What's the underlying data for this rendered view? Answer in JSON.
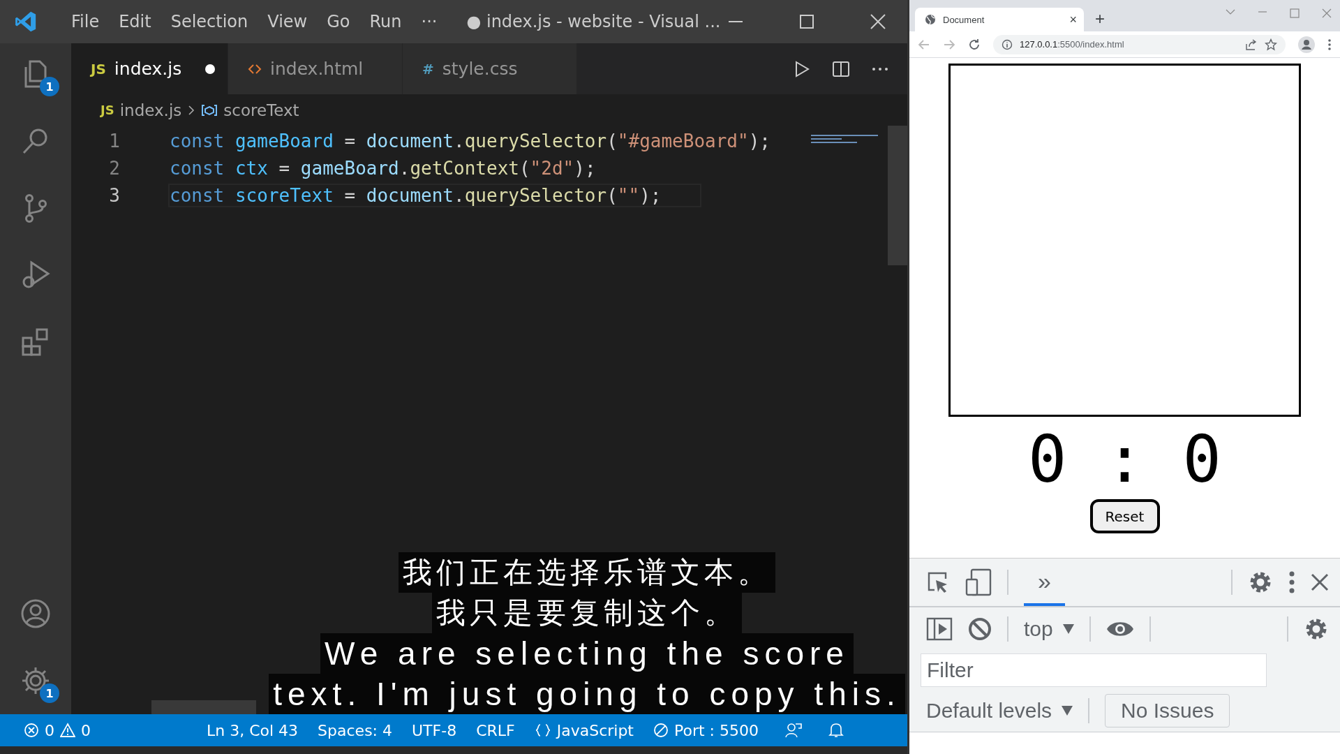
{
  "vscode": {
    "menu": [
      "File",
      "Edit",
      "Selection",
      "View",
      "Go",
      "Run",
      "···"
    ],
    "window_title": "● index.js - website - Visual ...",
    "activity_bar": [
      {
        "kind": "files",
        "badge": "1"
      },
      {
        "kind": "search"
      },
      {
        "kind": "source-control"
      },
      {
        "kind": "debug"
      },
      {
        "kind": "extensions"
      },
      {
        "kind": "account"
      },
      {
        "kind": "settings",
        "badge": "1"
      }
    ],
    "tabs": [
      {
        "kind": "js",
        "icon_label": "JS",
        "label": "index.js",
        "selected": true,
        "modified": true
      },
      {
        "kind": "html",
        "label": "index.html",
        "selected": false,
        "modified": false
      },
      {
        "kind": "css",
        "icon_label": "#",
        "label": "style.css",
        "selected": false,
        "modified": false
      }
    ],
    "breadcrumb": {
      "icon_label": "JS",
      "file": "index.js",
      "symbol": "scoreText"
    },
    "code_lines": [
      {
        "number": "1",
        "current": false,
        "tokens": [
          {
            "kind": "keyword",
            "text": "const "
          },
          {
            "kind": "variable",
            "text": "gameBoard"
          },
          {
            "kind": "plain",
            "text": " = "
          },
          {
            "kind": "object",
            "text": "document"
          },
          {
            "kind": "plain",
            "text": "."
          },
          {
            "kind": "function",
            "text": "querySelector"
          },
          {
            "kind": "plain",
            "text": "("
          },
          {
            "kind": "string",
            "text": "\"#gameBoard\""
          },
          {
            "kind": "plain",
            "text": ");"
          }
        ]
      },
      {
        "number": "2",
        "current": false,
        "tokens": [
          {
            "kind": "keyword",
            "text": "const "
          },
          {
            "kind": "variable",
            "text": "ctx"
          },
          {
            "kind": "plain",
            "text": " = "
          },
          {
            "kind": "object",
            "text": "gameBoard"
          },
          {
            "kind": "plain",
            "text": "."
          },
          {
            "kind": "function",
            "text": "getContext"
          },
          {
            "kind": "plain",
            "text": "("
          },
          {
            "kind": "string",
            "text": "\"2d\""
          },
          {
            "kind": "plain",
            "text": ");"
          }
        ]
      },
      {
        "number": "3",
        "current": true,
        "tokens": [
          {
            "kind": "keyword",
            "text": "const "
          },
          {
            "kind": "variable",
            "text": "scoreText"
          },
          {
            "kind": "plain",
            "text": " = "
          },
          {
            "kind": "object",
            "text": "document"
          },
          {
            "kind": "plain",
            "text": "."
          },
          {
            "kind": "function",
            "text": "querySelector"
          },
          {
            "kind": "plain",
            "text": "("
          },
          {
            "kind": "string",
            "text": "\"\""
          },
          {
            "kind": "plain",
            "text": ");"
          }
        ]
      }
    ],
    "status_bar": {
      "errors": "0",
      "warnings": "0",
      "items": [
        {
          "kind": "text",
          "label": "Ln 3, Col 43"
        },
        {
          "kind": "text",
          "label": "Spaces: 4"
        },
        {
          "kind": "text",
          "label": "UTF-8"
        },
        {
          "kind": "text",
          "label": "CRLF"
        },
        {
          "kind": "language",
          "label": "JavaScript"
        },
        {
          "kind": "port",
          "label": "Port : 5500"
        }
      ]
    }
  },
  "browser": {
    "tab": {
      "title": "Document",
      "close": "×"
    },
    "new_tab": "+",
    "url_host": "127.0.0.1",
    "url_rest": ":5500/index.html",
    "page": {
      "score": "0 : 0",
      "reset_button": "Reset"
    },
    "devtools": {
      "more_tabs": "»",
      "context": "top",
      "filter": {
        "placeholder": "Filter"
      },
      "levels": "Default levels",
      "issues": "No Issues"
    }
  },
  "subtitles": [
    "我们正在选择乐谱文本。",
    "我只是要复制这个。",
    "We are selecting the score",
    "text. I'm just going to copy this."
  ]
}
